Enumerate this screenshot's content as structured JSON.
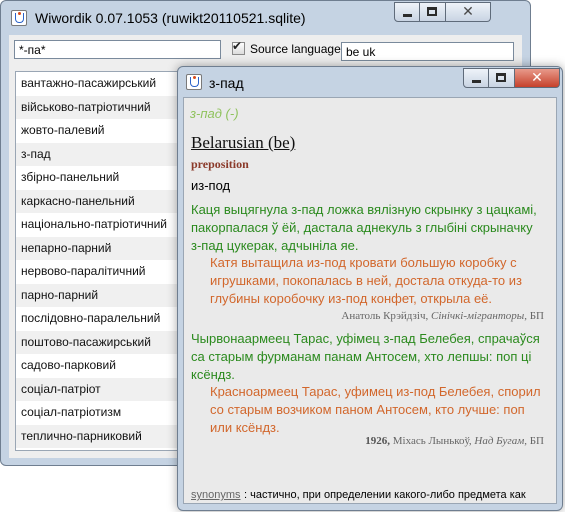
{
  "main_window": {
    "title": "Wiwordik 0.07.1053 (ruwikt20110521.sqlite)",
    "search": {
      "value": "*-па*"
    },
    "source_language": {
      "label": "Source language",
      "checked": true
    },
    "lang_filter": {
      "value": "be uk"
    },
    "word_list": [
      "вантажно-пасажирський",
      "військово-патріотичний",
      "жовто-палевий",
      "з-пад",
      "збірно-панельний",
      "каркасно-панельний",
      "національно-патріотичний",
      "непарно-парний",
      "нервово-паралітичний",
      "парно-парний",
      "послідовно-паралельний",
      "поштово-пасажирський",
      "садово-парковий",
      "соціал-патріот",
      "соціал-патріотизм",
      "теплично-парниковий"
    ]
  },
  "dialog": {
    "title": "з-пад",
    "header": "з-пад (-)",
    "language": "Belarusian (be)",
    "pos": "preposition",
    "translation": "из-под",
    "examples": [
      {
        "text": "Каця выцягнула з-пад ложка вялізную скрынку з цацкамі, пакорпалася ў ёй, дастала аднекуль з глыбіні скрыначку з-пад цукерак, адчыніла яе.",
        "translation": "Катя вытащила из-под кровати большую коробку с игрушками, покопалась в ней, достала откуда-то из глубины коробочку из-под конфет, открыла её.",
        "year": "",
        "author": "Анатоль Крэйдзіч,",
        "source": "Сінічкі-мігранторы",
        "ref": ", БП"
      },
      {
        "text": "Чырвонаармеец Тарас, уфімец з-пад Белебея, спрачаўся са старым фурманам панам Антосем, хто лепшы: поп ці ксёндз.",
        "translation": "Красноармеец Тарас, уфимец из-под Белебея, спорил со старым возчиком паном Антосем, кто лучше: поп или ксёндз.",
        "year": "1926,",
        "author": " Міхась Лынькоў,",
        "source": "Над Бугам",
        "ref": ", БП"
      }
    ],
    "synonyms_label": "synonyms",
    "synonyms_text": ": частично, при определении какого-либо предмета как вместилища для чего-либо: для"
  }
}
